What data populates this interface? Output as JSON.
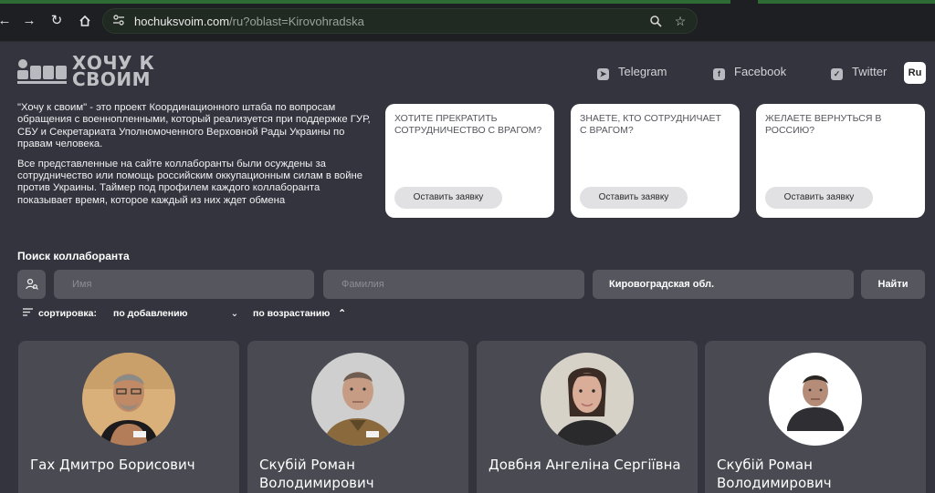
{
  "browser": {
    "url_host": "hochuksvoim.com",
    "url_path": "/ru?oblast=Kirovohradska",
    "colors": {
      "chrome": "#1d1f22",
      "omnibox": "#212a22"
    }
  },
  "site": {
    "logo_text_line1": "ХОЧУ К",
    "logo_text_line2": "СВОИМ",
    "social": {
      "telegram": "Telegram",
      "facebook": "Facebook",
      "twitter": "Twitter"
    },
    "language": "Ru"
  },
  "intro": {
    "paragraph1": "\"Хочу к своим\" - это проект Координационного штаба по вопросам обращения с военнопленными, который реализуется при поддержке ГУР, СБУ и Секретариата Уполномоченного Верховной Рады Украины по правам человека.",
    "paragraph2": "Все представленные на сайте коллаборанты были осуждены за сотрудничество или помощь российским оккупационным силам в войне против Украины. Таймер под профилем каждого коллаборанта показывает время, которое каждый из них ждет обмена"
  },
  "cards": [
    {
      "text": "Хотите прекратить сотрудничество с врагом?",
      "button": "Оставить заявку"
    },
    {
      "text": "Знаете, кто сотрудничает с врагом?",
      "button": "Оставить заявку"
    },
    {
      "text": "Желаете вернуться в Россию?",
      "button": "Оставить заявку"
    }
  ],
  "search": {
    "title": "Поиск коллаборанта",
    "first_name_placeholder": "Имя",
    "last_name_placeholder": "Фамилия",
    "region_value": "Кировоградская обл.",
    "find_button": "Найти"
  },
  "sort": {
    "label": "сортировка:",
    "by_value": "по добавлению",
    "order_value": "по возрастанию"
  },
  "people": [
    {
      "name": "Гах Дмитро Борисович",
      "avatar_bg": "#d9b07a"
    },
    {
      "name": "Скубій Роман Володимирович",
      "avatar_bg": "#cfcfcf"
    },
    {
      "name": "Довбня Ангеліна Сергіївна",
      "avatar_bg": "#d7d2c8"
    },
    {
      "name": "Скубій Роман Володимирович",
      "avatar_bg": "#ffffff"
    }
  ],
  "icons": {
    "back": "arrow-left-icon",
    "forward": "arrow-right-icon",
    "reload": "reload-icon",
    "home": "home-icon",
    "site_info": "tune-icon",
    "zoom": "zoom-icon",
    "bookmark": "star-icon"
  },
  "colors": {
    "page_bg": "#33343d",
    "field_bg": "#55565e",
    "person_card_bg": "#494a52",
    "card_bg": "#ffffff"
  }
}
